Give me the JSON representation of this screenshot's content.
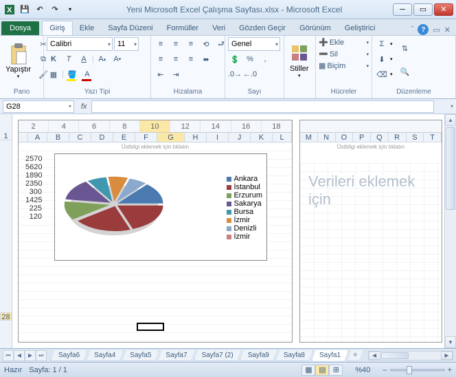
{
  "title": "Yeni Microsoft Excel Çalışma Sayfası.xlsx  -  Microsoft Excel",
  "tabs": {
    "file": "Dosya",
    "list": [
      "Giriş",
      "Ekle",
      "Sayfa Düzeni",
      "Formüller",
      "Veri",
      "Gözden Geçir",
      "Görünüm",
      "Geliştirici"
    ],
    "active": 0
  },
  "ribbon": {
    "clipboard": {
      "paste": "Yapıştır",
      "label": "Pano"
    },
    "font": {
      "name": "Calibri",
      "size": "11",
      "label": "Yazı Tipi"
    },
    "align": {
      "label": "Hizalama"
    },
    "number": {
      "format": "Genel",
      "label": "Sayı"
    },
    "styles": {
      "btn": "Stiller"
    },
    "cells": {
      "insert": "Ekle",
      "delete": "Sil",
      "format": "Biçim",
      "label": "Hücreler"
    },
    "editing": {
      "label": "Düzenleme"
    }
  },
  "namebox": "G28",
  "fx": "fx",
  "page1": {
    "header": "Üstbilgi eklemek için tıklatın",
    "ruler": [
      "2",
      "4",
      "6",
      "8",
      "10",
      "12",
      "14",
      "16",
      "18"
    ],
    "cols": [
      "A",
      "B",
      "C",
      "D",
      "E",
      "F",
      "G",
      "H",
      "I",
      "J",
      "K",
      "L"
    ],
    "selCol": "G",
    "data": [
      "2570",
      "5620",
      "1890",
      "2350",
      "300",
      "1425",
      "225",
      "120"
    ],
    "rows_shown": [
      "28"
    ],
    "active_cell_ref": "G28"
  },
  "page2": {
    "header": "Üstbilgi eklemek için tıklatın",
    "cols": [
      "M",
      "N",
      "O",
      "P",
      "Q",
      "R",
      "S",
      "T"
    ],
    "watermark": "Verileri eklemek için"
  },
  "chart_data": {
    "type": "pie",
    "categories": [
      "Ankara",
      "İstanbul",
      "Erzurum",
      "Sakarya",
      "Bursa",
      "İzmir",
      "Denizli",
      "İzmir"
    ],
    "values": [
      2570,
      5620,
      1890,
      2350,
      300,
      1425,
      225,
      120
    ],
    "colors": [
      "#4a7ab0",
      "#9a3c3c",
      "#7ea05a",
      "#6a5693",
      "#3f98b0",
      "#d98b3e",
      "#8aa9cc",
      "#c77f7f"
    ],
    "title": "",
    "style": "3D exploded pie"
  },
  "sheets": [
    "Sayfa6",
    "Sayfa4",
    "Sayfa5",
    "Sayfa7",
    "Sayfa7 (2)",
    "Sayfa9",
    "Sayfa8",
    "Sayfa1"
  ],
  "active_sheet": "Sayfa1",
  "status": {
    "ready": "Hazır",
    "page": "Sayfa: 1 / 1",
    "zoom": "%40",
    "zoom_value": 40
  }
}
